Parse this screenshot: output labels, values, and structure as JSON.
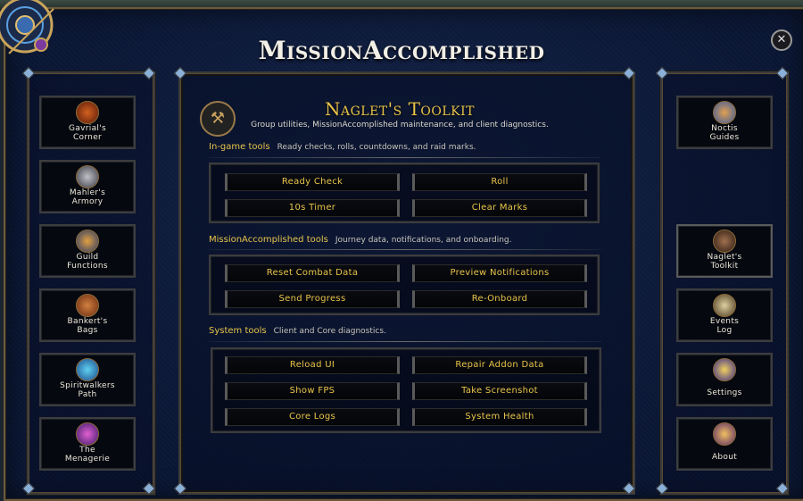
{
  "window": {
    "title": "MissionAccomplished"
  },
  "toolkit": {
    "title": "Naglet's Toolkit",
    "subtitle": "Group utilities, MissionAccomplished maintenance, and client diagnostics."
  },
  "sidebar_left": [
    {
      "label_1": "Gavrial's",
      "label_2": "Corner",
      "icon": "gavrial-icon"
    },
    {
      "label_1": "Mahler's",
      "label_2": "Armory",
      "icon": "armory-icon"
    },
    {
      "label_1": "Guild",
      "label_2": "Functions",
      "icon": "guild-icon"
    },
    {
      "label_1": "Bankert's",
      "label_2": "Bags",
      "icon": "bags-icon"
    },
    {
      "label_1": "Spiritwalkers",
      "label_2": "Path",
      "icon": "spiritwalker-icon"
    },
    {
      "label_1": "The",
      "label_2": "Menagerie",
      "icon": "menagerie-icon"
    }
  ],
  "sidebar_right": [
    {
      "label_1": "Noctis",
      "label_2": "Guides",
      "icon": "noctis-icon"
    },
    {
      "label_1": "Naglet's",
      "label_2": "Toolkit",
      "icon": "toolkit-icon"
    },
    {
      "label_1": "Events",
      "label_2": "Log",
      "icon": "events-log-icon"
    },
    {
      "label_1": "",
      "label_2": "Settings",
      "icon": "settings-icon"
    },
    {
      "label_1": "",
      "label_2": "About",
      "icon": "about-icon"
    }
  ],
  "sections": [
    {
      "title": "In-game tools",
      "desc": "Ready checks, rolls, countdowns, and raid marks.",
      "buttons": [
        "Ready Check",
        "Roll",
        "10s Timer",
        "Clear Marks"
      ]
    },
    {
      "title": "MissionAccomplished tools",
      "desc": "Journey data, notifications, and onboarding.",
      "buttons": [
        "Reset Combat Data",
        "Preview Notifications",
        "Send Progress",
        "Re-Onboard"
      ]
    },
    {
      "title": "System tools",
      "desc": "Client and Core diagnostics.",
      "buttons": [
        "Reload UI",
        "Repair Addon Data",
        "Show FPS",
        "Take Screenshot",
        "Core Logs",
        "System Health"
      ]
    }
  ],
  "colors": {
    "accent_gold": "#e8c44a",
    "panel_bg": "#0d1a38",
    "border": "#3c3c3c"
  }
}
